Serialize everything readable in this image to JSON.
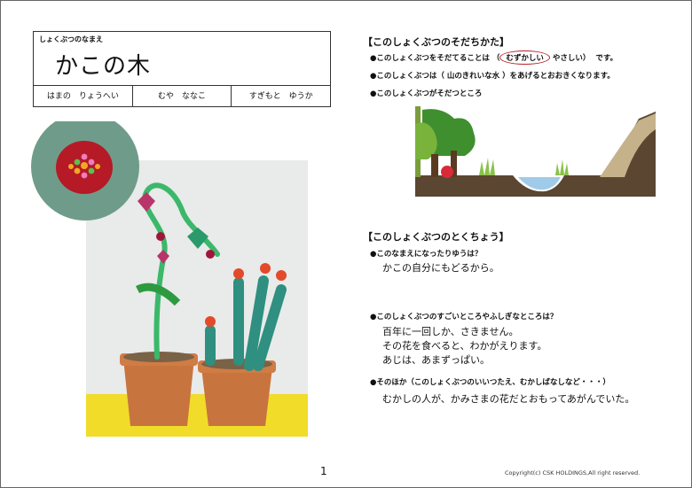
{
  "name_section": {
    "label": "しょくぶつのなまえ",
    "plant_name": "かこの木",
    "authors": [
      "はまの　りょうへい",
      "むや　ななこ",
      "すぎもと　ゆうか"
    ]
  },
  "growing": {
    "heading": "【このしょくぶつのそだちかた】",
    "difficulty_prefix": "●このしょくぶつをそだてることは",
    "difficulty_selected": "むずかしい",
    "difficulty_other": "やさしい）",
    "difficulty_suffix": "です。",
    "water_prefix": "●このしょくぶつは（",
    "water_value": "山のきれいな水",
    "water_suffix": "）をあげるとおおきくなります。",
    "place_question": "●このしょくぶつがそだつところ"
  },
  "features": {
    "heading": "【このしょくぶつのとくちょう】",
    "q1": "●このなまえになったりゆうは？",
    "a1": "かこの自分にもどるから。",
    "q2": "●このしょくぶつのすごいところやふしぎなところは？",
    "a2": [
      "百年に一回しか、さきません。",
      "その花を食べると、わかがえります。",
      "あじは、あまずっぱい。"
    ],
    "q3": "●そのほか（このしょくぶつのいいつたえ、むかしばなしなど・・・）",
    "a3": "むかしの人が、かみさまの花だとおもってあがんでいた。"
  },
  "footer": {
    "page_number": "1",
    "copyright": "Copyright(c) CSK HOLDINGS,All right reserved."
  },
  "colors": {
    "circle_accent": "#b3212c",
    "ground": "#5b4632",
    "water": "#9fcbe8",
    "tree_green": "#3f8f2f"
  }
}
